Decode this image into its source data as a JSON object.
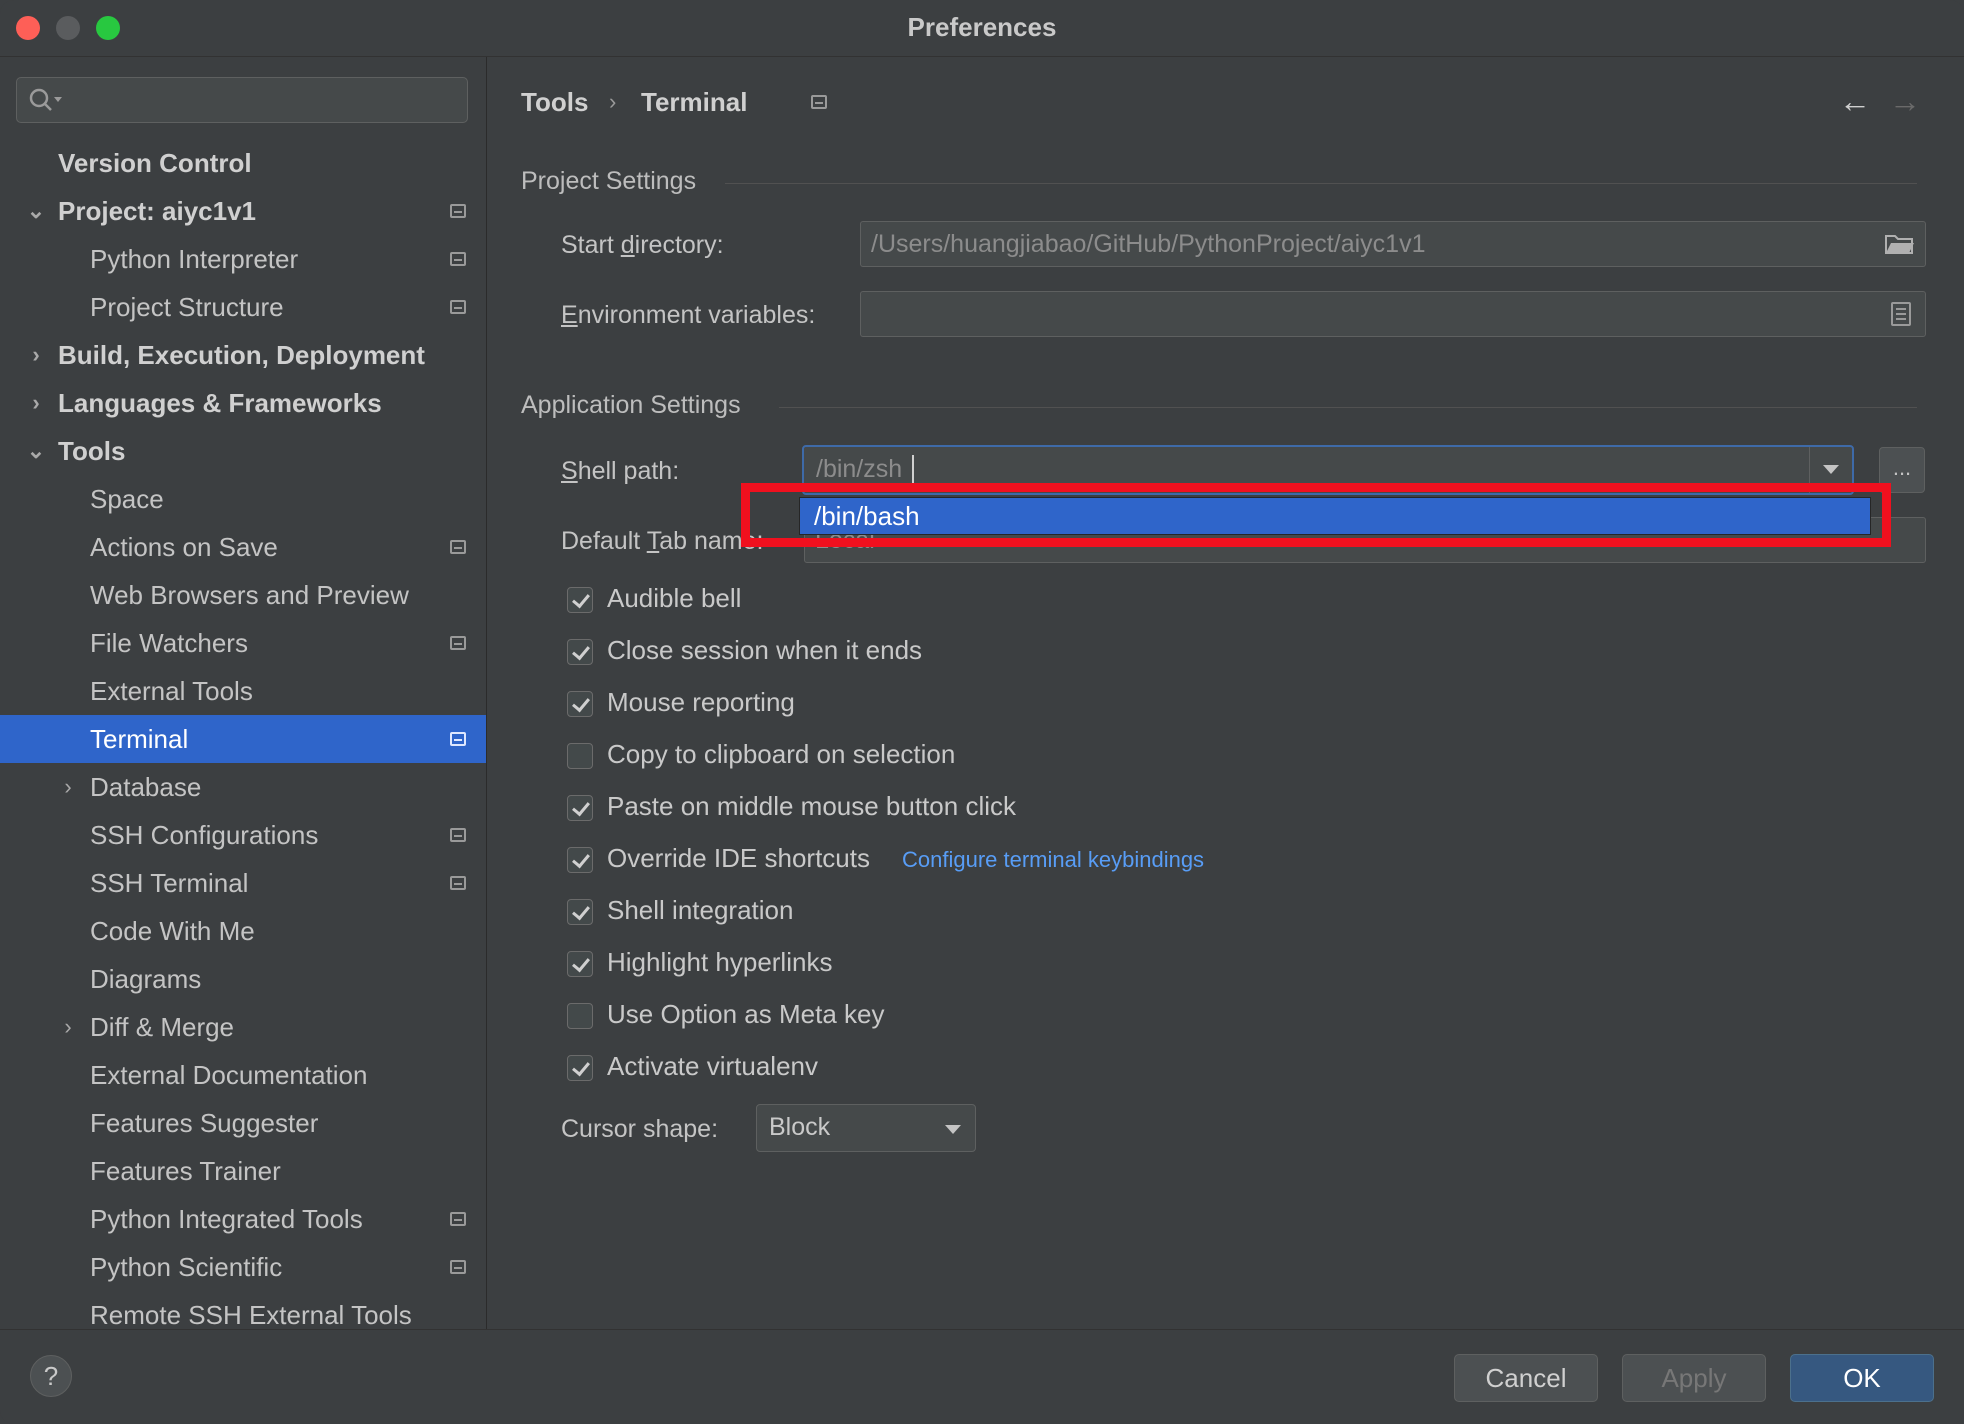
{
  "window": {
    "title": "Preferences"
  },
  "sidebar": {
    "search": {
      "placeholder": ""
    },
    "items": [
      {
        "label": "Version Control"
      },
      {
        "label": "Project: aiyc1v1"
      },
      {
        "label": "Python Interpreter"
      },
      {
        "label": "Project Structure"
      },
      {
        "label": "Build, Execution, Deployment"
      },
      {
        "label": "Languages & Frameworks"
      },
      {
        "label": "Tools"
      },
      {
        "label": "Space"
      },
      {
        "label": "Actions on Save"
      },
      {
        "label": "Web Browsers and Preview"
      },
      {
        "label": "File Watchers"
      },
      {
        "label": "External Tools"
      },
      {
        "label": "Terminal"
      },
      {
        "label": "Database"
      },
      {
        "label": "SSH Configurations"
      },
      {
        "label": "SSH Terminal"
      },
      {
        "label": "Code With Me"
      },
      {
        "label": "Diagrams"
      },
      {
        "label": "Diff & Merge"
      },
      {
        "label": "External Documentation"
      },
      {
        "label": "Features Suggester"
      },
      {
        "label": "Features Trainer"
      },
      {
        "label": "Python Integrated Tools"
      },
      {
        "label": "Python Scientific"
      },
      {
        "label": "Remote SSH External Tools"
      }
    ]
  },
  "breadcrumb": {
    "parent": "Tools",
    "separator": "›",
    "current": "Terminal"
  },
  "project_settings": {
    "title": "Project Settings",
    "start_directory": {
      "label_pre": "Start ",
      "label_mnemonic": "d",
      "label_post": "irectory:",
      "value": "/Users/huangjiabao/GitHub/PythonProject/aiyc1v1"
    },
    "env_vars": {
      "label_mnemonic": "E",
      "label_post": "nvironment variables:",
      "value": ""
    }
  },
  "app_settings": {
    "title": "Application Settings",
    "shell_path": {
      "label_mnemonic": "S",
      "label_post": "hell path:",
      "value": "/bin/zsh",
      "dropdown_option": "/bin/bash",
      "browse": "..."
    },
    "default_tab": {
      "label_pre": "Default ",
      "label_mnemonic": "T",
      "label_post": "ab name:",
      "value": "Local"
    },
    "checkboxes": [
      {
        "label": "Audible bell",
        "checked": true
      },
      {
        "label": "Close session when it ends",
        "checked": true
      },
      {
        "label": "Mouse reporting",
        "checked": true
      },
      {
        "label": "Copy to clipboard on selection",
        "checked": false
      },
      {
        "label": "Paste on middle mouse button click",
        "checked": true
      },
      {
        "label": "Override IDE shortcuts",
        "checked": true
      },
      {
        "label": "Shell integration",
        "checked": true
      },
      {
        "label": "Highlight hyperlinks",
        "checked": true
      },
      {
        "label": "Use Option as Meta key",
        "checked": false
      },
      {
        "label": "Activate virtualenv",
        "checked": true
      }
    ],
    "keybindings_link": "Configure terminal keybindings",
    "cursor_shape": {
      "label": "Cursor shape:",
      "value": "Block"
    }
  },
  "footer": {
    "help": "?",
    "cancel": "Cancel",
    "apply": "Apply",
    "ok": "OK"
  },
  "colors": {
    "accent": "#2f65ca",
    "highlight": "#f0101e",
    "link": "#589df6"
  }
}
